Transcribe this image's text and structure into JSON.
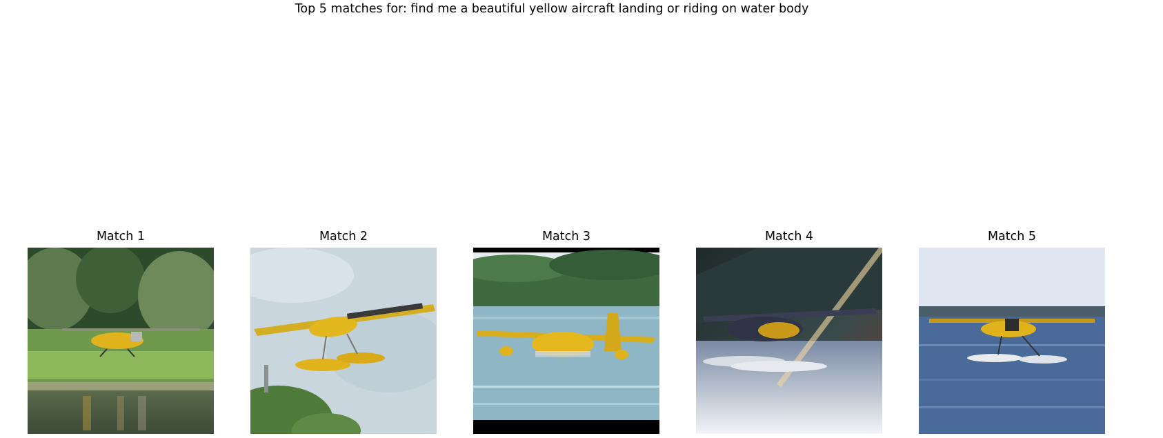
{
  "figure": {
    "suptitle": "Top 5 matches for: find me a beautiful yellow aircraft landing or riding on water body"
  },
  "matches": [
    {
      "title": "Match 1"
    },
    {
      "title": "Match 2"
    },
    {
      "title": "Match 3"
    },
    {
      "title": "Match 4"
    },
    {
      "title": "Match 5"
    }
  ],
  "colors": {
    "aircraft_yellow": "#e0b21c",
    "water_blue": "#4a6a9a",
    "forest_green": "#3a5a33"
  }
}
